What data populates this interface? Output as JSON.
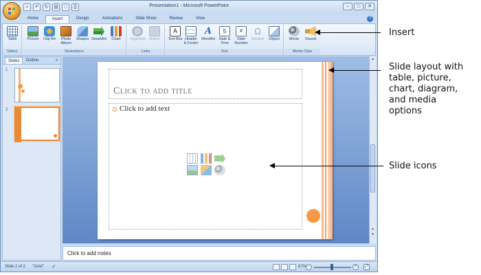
{
  "window": {
    "title": "Presentation1 - Microsoft PowerPoint",
    "controls": [
      "–",
      "□",
      "✕"
    ]
  },
  "ribbon": {
    "tabs": [
      "Home",
      "Insert",
      "Design",
      "Animations",
      "Slide Show",
      "Review",
      "View"
    ],
    "active_tab": "Insert",
    "groups": [
      {
        "label": "Tables",
        "buttons": [
          {
            "label": "Table",
            "icon": "table-icon"
          }
        ]
      },
      {
        "label": "Illustrations",
        "buttons": [
          {
            "label": "Picture",
            "icon": "picture-icon"
          },
          {
            "label": "Clip Art",
            "icon": "clip-art-icon"
          },
          {
            "label": "Photo Album",
            "icon": "photo-album-icon"
          },
          {
            "label": "Shapes",
            "icon": "shapes-icon"
          },
          {
            "label": "SmartArt",
            "icon": "smartart-icon"
          },
          {
            "label": "Chart",
            "icon": "chart-icon"
          }
        ]
      },
      {
        "label": "Links",
        "buttons": [
          {
            "label": "Hyperlink",
            "icon": "hyperlink-icon"
          },
          {
            "label": "Action",
            "icon": "action-icon"
          }
        ]
      },
      {
        "label": "Text",
        "buttons": [
          {
            "label": "Text Box",
            "icon": "text-box-icon"
          },
          {
            "label": "Header & Footer",
            "icon": "header-footer-icon"
          },
          {
            "label": "WordArt",
            "icon": "wordart-icon"
          },
          {
            "label": "Date & Time",
            "icon": "date-time-icon"
          },
          {
            "label": "Slide Number",
            "icon": "slide-number-icon"
          },
          {
            "label": "Symbol",
            "icon": "symbol-icon"
          },
          {
            "label": "Object",
            "icon": "object-icon"
          }
        ]
      },
      {
        "label": "Media Clips",
        "buttons": [
          {
            "label": "Movie",
            "icon": "movie-icon"
          },
          {
            "label": "Sound",
            "icon": "sound-icon"
          }
        ]
      }
    ]
  },
  "slides_pane": {
    "tabs": [
      "Slides",
      "Outline"
    ],
    "active_tab": "Slides",
    "close": "x",
    "thumbnails": [
      {
        "number": "1"
      },
      {
        "number": "2",
        "selected": true
      }
    ]
  },
  "slide": {
    "title_placeholder": "Click to add title",
    "content_placeholder": "Click to add text"
  },
  "notes": {
    "placeholder": "Click to add notes"
  },
  "status": {
    "slide_counter": "Slide 2 of 2",
    "theme": "\"Oriel\"",
    "zoom": "67%"
  },
  "callouts": {
    "insert": "Insert",
    "layout": [
      "Slide layout with",
      "table, picture,",
      "chart, diagram,",
      "and media",
      "options"
    ],
    "icons": "Slide icons"
  },
  "colors": {
    "accent": "#e8833a",
    "ribbon_blue": "#c9dcf2"
  }
}
